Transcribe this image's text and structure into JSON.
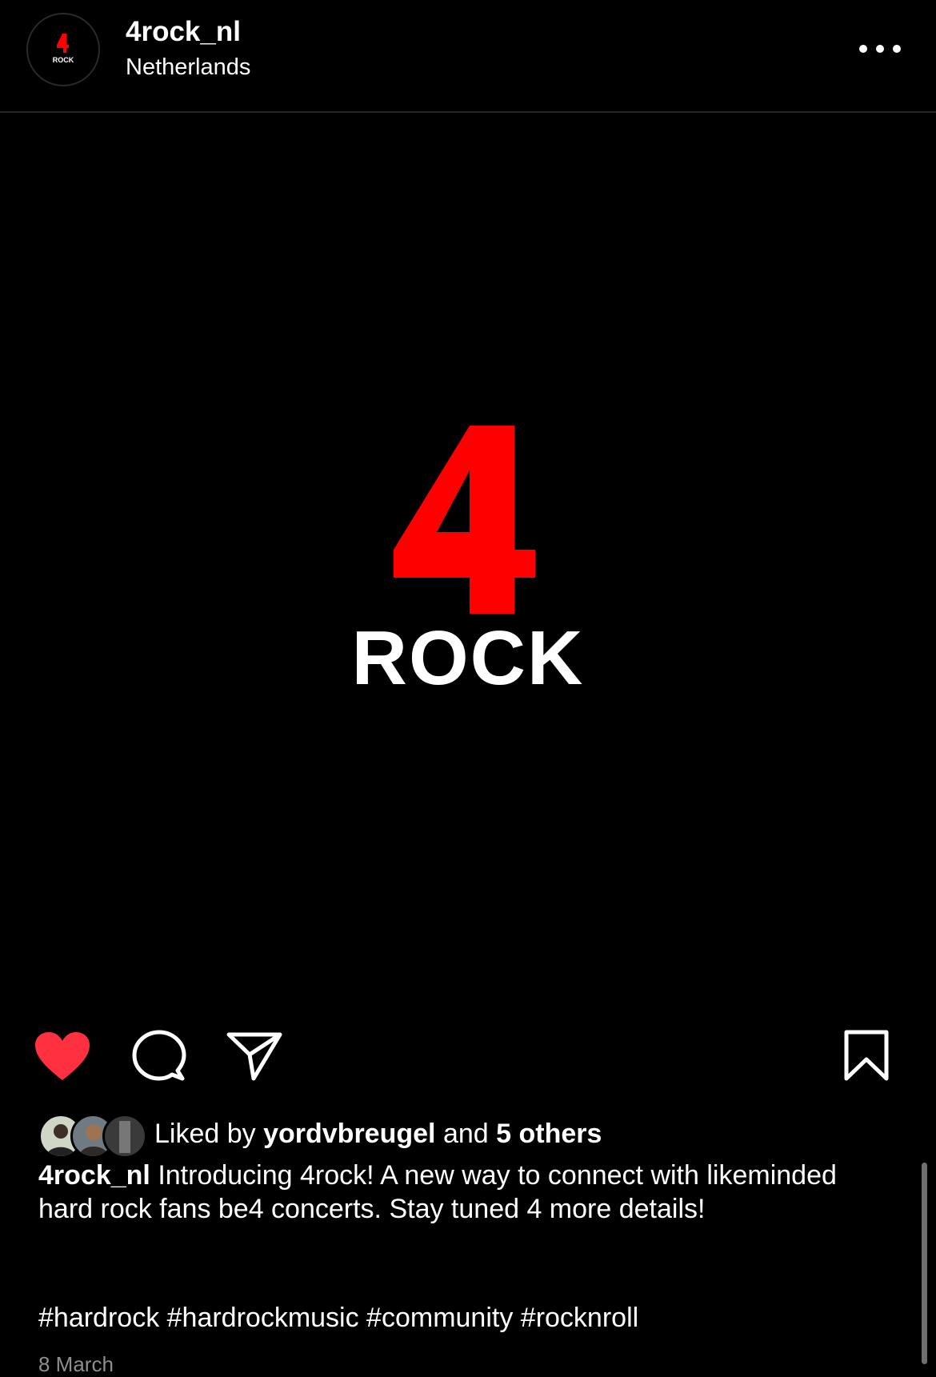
{
  "post": {
    "username": "4rock_nl",
    "location": "Netherlands",
    "avatar_logo": {
      "number": "4",
      "word": "ROCK"
    },
    "image_logo": {
      "number": "4",
      "word": "ROCK"
    },
    "colors": {
      "brand_red": "#ff0000",
      "heart_red": "#ff3040",
      "background": "#000000",
      "muted": "#8e8e8e"
    }
  },
  "actions": {
    "like_icon": "heart-filled-icon",
    "comment_icon": "comment-icon",
    "share_icon": "paper-plane-icon",
    "save_icon": "bookmark-icon",
    "more_icon": "ellipsis-icon",
    "liked": true
  },
  "likes": {
    "prefix": "Liked by",
    "user": "yordvbreugel",
    "connector": "and",
    "others": "5 others"
  },
  "caption": {
    "username": "4rock_nl",
    "text": "Introducing 4rock! A new way to connect with likeminded hard rock fans be4 concerts. Stay tuned 4 more details!",
    "hashtags": "#hardrock #hardrockmusic #community #rocknroll"
  },
  "date": "8 March"
}
